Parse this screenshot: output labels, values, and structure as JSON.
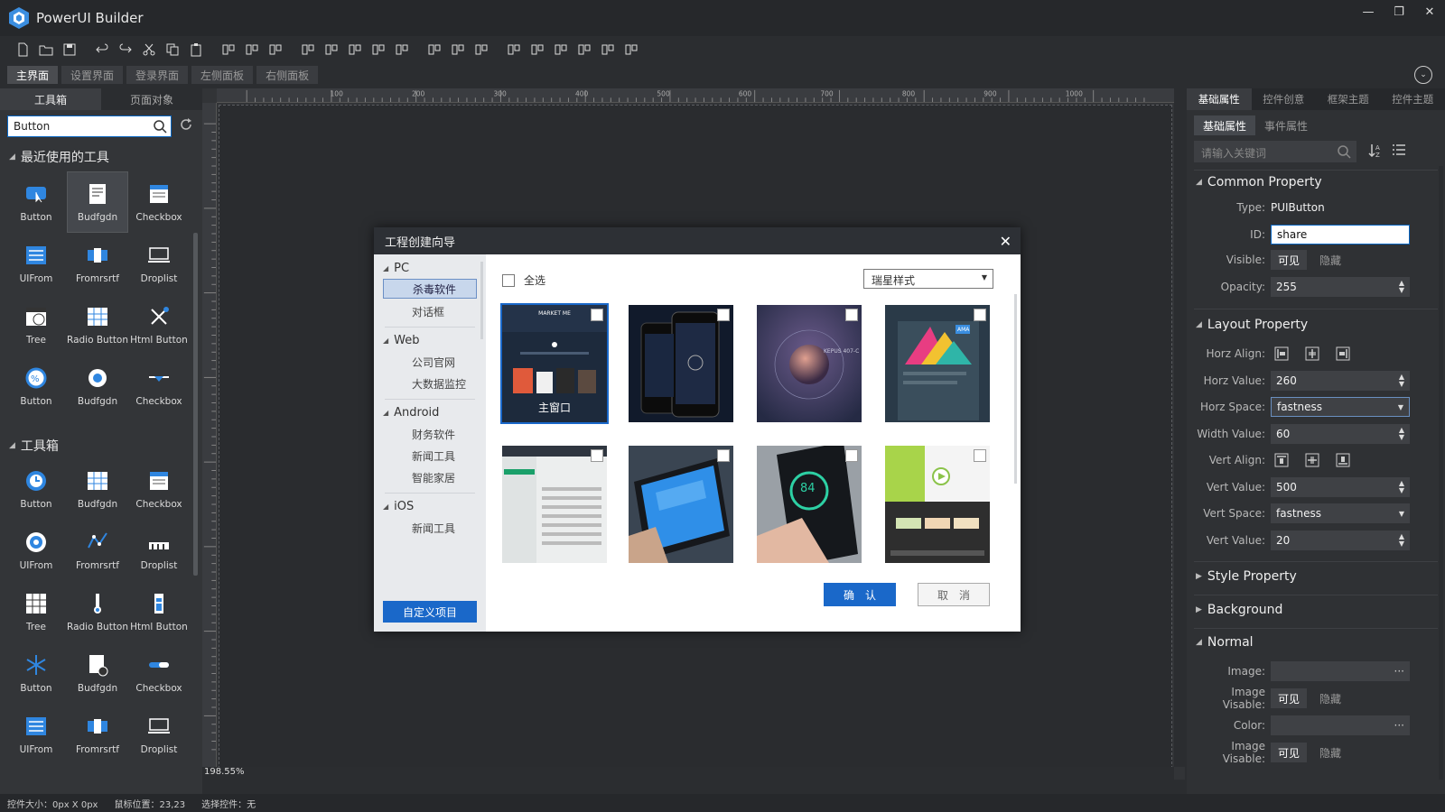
{
  "app": {
    "title": "PowerUI Builder"
  },
  "colors": {
    "accent": "#1a68c9",
    "bg": "#2b2d30",
    "panel": "#333538"
  },
  "toolbar": {
    "icons": [
      "new-file-icon",
      "open-folder-icon",
      "save-icon",
      "undo-icon",
      "redo-icon",
      "cut-icon",
      "copy-icon",
      "paste-icon",
      "align-top-icon",
      "align-vcenter-icon",
      "align-bottom-icon",
      "align-left-icon",
      "align-hcenter-icon",
      "align-right-icon",
      "distribute-horizontal-icon",
      "distribute-vertical-icon",
      "same-width-icon",
      "same-height-icon",
      "same-size-icon",
      "move-left-icon",
      "move-right-icon",
      "move-down-icon",
      "move-up-icon",
      "center-icon",
      "preview-icon"
    ]
  },
  "page_tabs": [
    "主界面",
    "设置界面",
    "登录界面",
    "左侧面板",
    "右侧面板"
  ],
  "left": {
    "tabs": [
      "工具箱",
      "页面对象"
    ],
    "search_value": "Button",
    "recent_title": "最近使用的工具",
    "toolbox_title": "工具箱",
    "recent": [
      {
        "label": "Button",
        "icon": "button-icon"
      },
      {
        "label": "Budfgdn",
        "icon": "form-icon"
      },
      {
        "label": "Checkbox",
        "icon": "checkbox-icon"
      },
      {
        "label": "UIFrom",
        "icon": "list-icon"
      },
      {
        "label": "Fromrsrtf",
        "icon": "carousel-icon"
      },
      {
        "label": "Droplist",
        "icon": "droplist-icon"
      },
      {
        "label": "Tree",
        "icon": "calendar-icon"
      },
      {
        "label": "Radio Button",
        "icon": "grid-icon"
      },
      {
        "label": "Html Button",
        "icon": "tools-icon"
      },
      {
        "label": "Button",
        "icon": "percent-icon"
      },
      {
        "label": "Budfgdn",
        "icon": "radio-icon"
      },
      {
        "label": "Checkbox",
        "icon": "dropdown-icon"
      }
    ],
    "toolbox": [
      {
        "label": "Button",
        "icon": "clock-icon"
      },
      {
        "label": "Budfgdn",
        "icon": "grid-icon"
      },
      {
        "label": "Checkbox",
        "icon": "checkbox-icon"
      },
      {
        "label": "UIFrom",
        "icon": "target-icon"
      },
      {
        "label": "Fromrsrtf",
        "icon": "line-chart-icon"
      },
      {
        "label": "Droplist",
        "icon": "bar-icon"
      },
      {
        "label": "Tree",
        "icon": "table-icon"
      },
      {
        "label": "Radio Button",
        "icon": "thermometer-icon"
      },
      {
        "label": "Html Button",
        "icon": "battery-icon"
      },
      {
        "label": "Button",
        "icon": "snowflake-icon"
      },
      {
        "label": "Budfgdn",
        "icon": "document-icon"
      },
      {
        "label": "Checkbox",
        "icon": "toggle-icon"
      },
      {
        "label": "UIFrom",
        "icon": "list-icon"
      },
      {
        "label": "Fromrsrtf",
        "icon": "carousel-icon"
      },
      {
        "label": "Droplist",
        "icon": "droplist-icon"
      }
    ]
  },
  "ruler": {
    "labels": [
      "100",
      "200",
      "300",
      "400",
      "500",
      "600",
      "700",
      "800",
      "900",
      "1000"
    ]
  },
  "canvas": {
    "zoom": "198.55%"
  },
  "dialog": {
    "title": "工程创建向导",
    "select_all": "全选",
    "style_select": "瑞星样式",
    "ok": "确认",
    "cancel": "取消",
    "custom_project": "自定义项目",
    "groups": [
      {
        "name": "PC",
        "items": [
          "杀毒软件",
          "对话框"
        ]
      },
      {
        "name": "Web",
        "items": [
          "公司官网",
          "大数据监控"
        ]
      },
      {
        "name": "Android",
        "items": [
          "财务软件",
          "新闻工具",
          "智能家居"
        ]
      },
      {
        "name": "iOS",
        "items": [
          "新闻工具"
        ]
      }
    ],
    "thumb_caption": "主窗口",
    "thumb_text": {
      "market": "MARKET ME",
      "kepus": "KEPUS 407-C",
      "num": "84",
      "ama": "AMA"
    }
  },
  "right": {
    "tabs": [
      "基础属性",
      "控件创意",
      "框架主题",
      "控件主题"
    ],
    "subtabs": [
      "基础属性",
      "事件属性"
    ],
    "search_placeholder": "请输入关键词",
    "common": {
      "title": "Common Property",
      "type_label": "Type:",
      "type_value": "PUIButton",
      "id_label": "ID:",
      "id_value": "share",
      "visible_label": "Visible:",
      "visible_on": "可见",
      "visible_off": "隐藏",
      "opacity_label": "Opacity:",
      "opacity_value": "255"
    },
    "layout": {
      "title": "Layout Property",
      "horz_align_label": "Horz Align:",
      "horz_value_label": "Horz Value:",
      "horz_value": "260",
      "horz_space_label": "Horz Space:",
      "horz_space": "fastness",
      "width_label": "Width Value:",
      "width_value": "60",
      "vert_align_label": "Vert Align:",
      "vert_value_label": "Vert Value:",
      "vert_value": "500",
      "vert_space_label": "Vert Space:",
      "vert_space": "fastness",
      "vert_value2_label": "Vert Value:",
      "vert_value2": "20"
    },
    "style_title": "Style Property",
    "background_title": "Background",
    "normal": {
      "title": "Normal",
      "image_label": "Image:",
      "image_visable_label": "Image Visable:",
      "on": "可见",
      "off": "隐藏",
      "color_label": "Color:",
      "image_visable2_label": "Image Visable:"
    }
  },
  "status": {
    "size": "控件大小：0px X 0px",
    "mouse": "鼠标位置：23,23",
    "selected": "选择控件：无"
  }
}
